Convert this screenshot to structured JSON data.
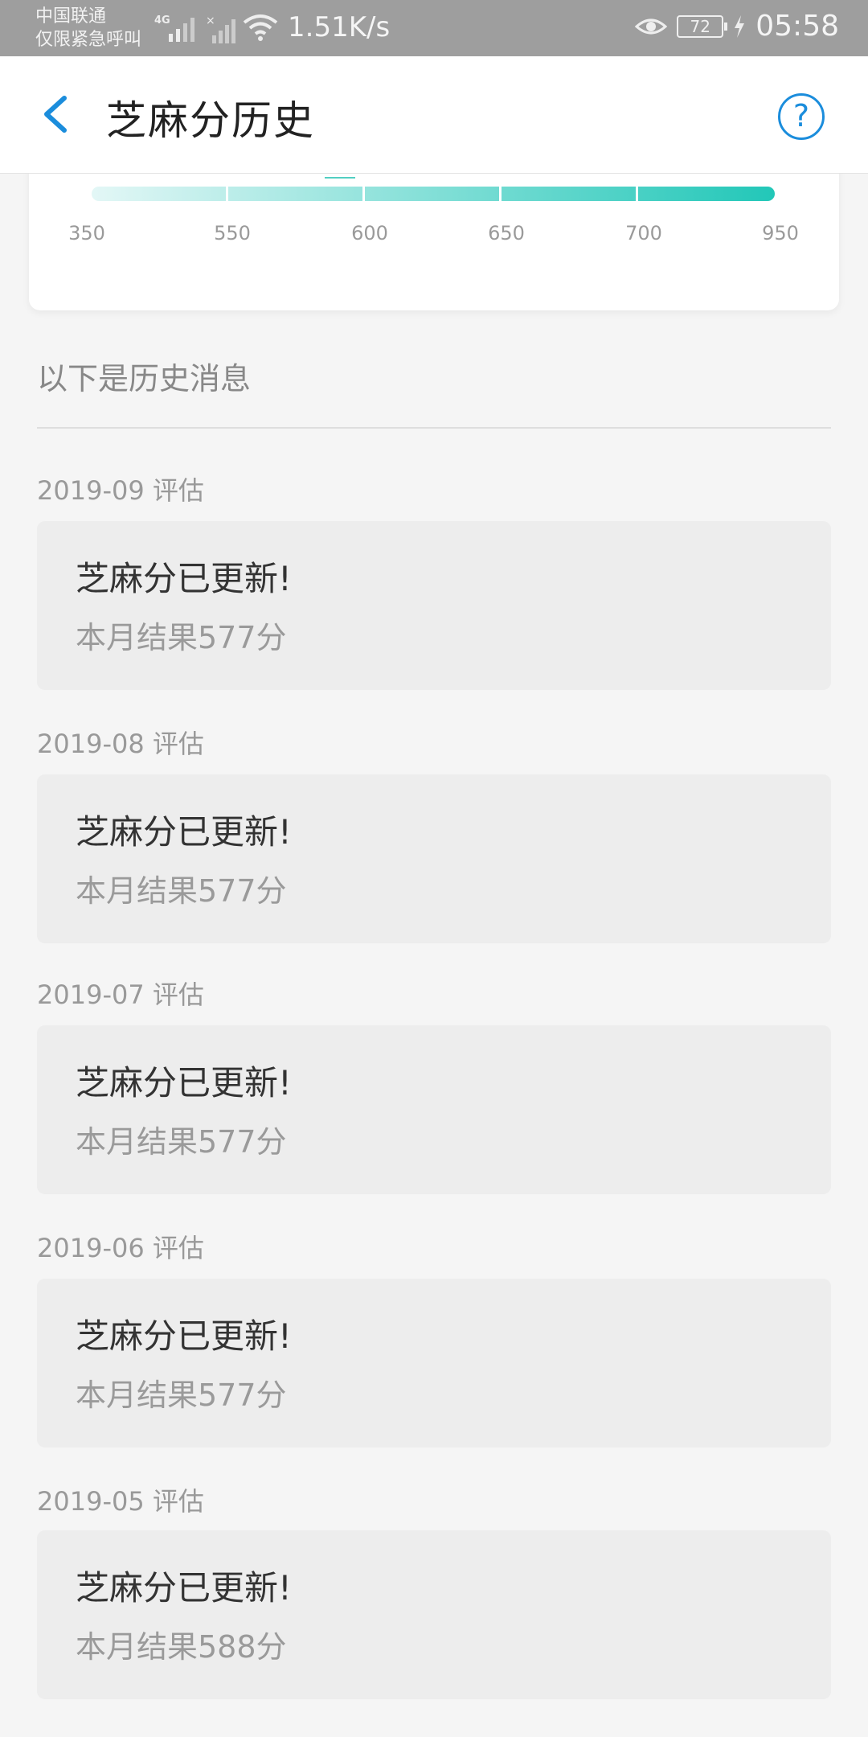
{
  "status_bar": {
    "carrier_line1": "中国联通",
    "carrier_line2": "仅限紧急呼叫",
    "net_label": "4G",
    "net_speed": "1.51K/s",
    "battery": "72",
    "time": "05:58"
  },
  "nav": {
    "title": "芝麻分历史",
    "help_symbol": "?"
  },
  "score_scale": {
    "ticks": [
      "350",
      "550",
      "600",
      "650",
      "700",
      "950"
    ]
  },
  "history": {
    "header": "以下是历史消息",
    "entries": [
      {
        "date": "2019-09 评估",
        "title": "芝麻分已更新!",
        "result": "本月结果577分"
      },
      {
        "date": "2019-08 评估",
        "title": "芝麻分已更新!",
        "result": "本月结果577分"
      },
      {
        "date": "2019-07 评估",
        "title": "芝麻分已更新!",
        "result": "本月结果577分"
      },
      {
        "date": "2019-06 评估",
        "title": "芝麻分已更新!",
        "result": "本月结果577分"
      },
      {
        "date": "2019-05 评估",
        "title": "芝麻分已更新!",
        "result": "本月结果588分"
      }
    ]
  },
  "colors": {
    "accent_blue": "#1b8ddc",
    "score_teal": "#22c7b8",
    "card_bg": "#ededed"
  }
}
